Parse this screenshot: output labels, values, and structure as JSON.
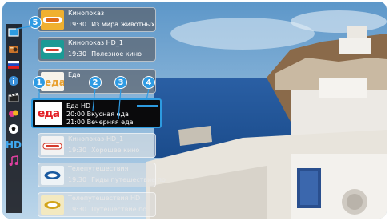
{
  "badges": [
    "5",
    "1",
    "2",
    "3",
    "4"
  ],
  "categories": [
    {
      "icon": "tv-icon"
    },
    {
      "icon": "radio-icon"
    },
    {
      "icon": "flag-icon"
    },
    {
      "icon": "info-icon"
    },
    {
      "icon": "film-icon"
    },
    {
      "icon": "children-icon"
    },
    {
      "icon": "sport-icon"
    },
    {
      "icon": "hd-icon",
      "label": "HD"
    },
    {
      "icon": "music-icon"
    }
  ],
  "channels": [
    {
      "name": "Кинопоказ",
      "time": "19:30",
      "program": "Из мира животных"
    },
    {
      "name": "Кинопоказ HD_1",
      "time": "19:30",
      "program": "Полезное кино"
    },
    {
      "name": "Еда",
      "time": "",
      "program": ""
    },
    {
      "name": "Кинопоказ-HD_1",
      "time": "19:30",
      "program": "Хорошее кино"
    },
    {
      "name": "Телепутешествия",
      "time": "19:30",
      "program": "Гиды путешествие по"
    },
    {
      "name": "Телепутешествия HD",
      "time": "19:30",
      "program": "Путешествие по"
    }
  ],
  "selected": {
    "logo_text": "еда",
    "name": "Еда HD",
    "now_time": "20:00",
    "now_program": "Вкусная еда",
    "next_time": "21:00",
    "next_program": "Вечерняя еда"
  },
  "colors": {
    "accent": "#2d9be0",
    "brand_red": "#e31e24"
  }
}
